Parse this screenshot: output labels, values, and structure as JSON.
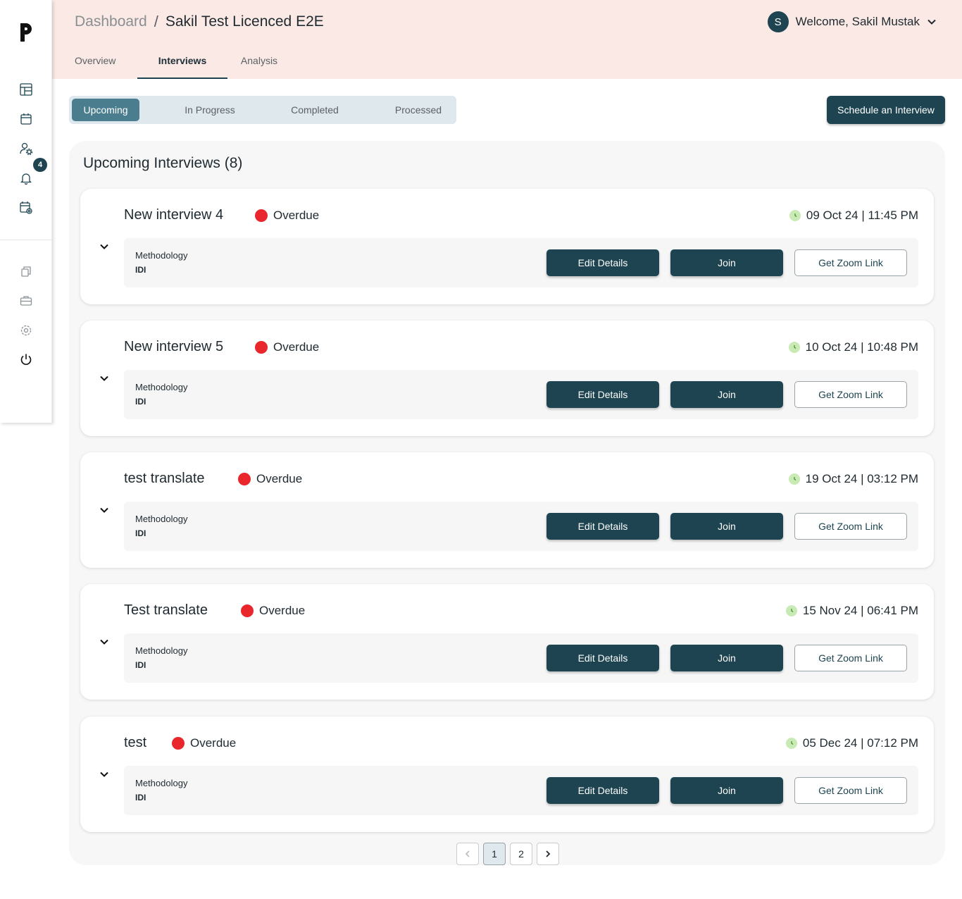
{
  "header": {
    "breadcrumb": [
      "Dashboard",
      "/",
      "Sakil Test Licenced E2E"
    ],
    "welcome": "Welcome, Sakil Mustak",
    "avatar_initial": "S",
    "tabs": [
      "Overview",
      "Interviews",
      "Analysis"
    ],
    "active_tab": "Interviews"
  },
  "sidebar": {
    "notification_count": "4",
    "icons_top": [
      "dashboard-grid-icon",
      "calendar-icon",
      "user-settings-icon",
      "bell-icon",
      "calendar-settings-icon"
    ],
    "icons_bottom": [
      "copy-icon",
      "briefcase-icon",
      "gear-icon",
      "power-icon"
    ]
  },
  "filters": {
    "options": [
      "Upcoming",
      "In Progress",
      "Completed",
      "Processed"
    ],
    "active": "Upcoming"
  },
  "schedule_button": "Schedule an Interview",
  "panel_title": "Upcoming Interviews (8)",
  "interviews": [
    {
      "name": "New interview 4",
      "status": "Overdue",
      "datetime": "09 Oct 24 | 11:45 PM",
      "methodology_label": "Methodology",
      "methodology": "IDI",
      "edit": "Edit Details",
      "join": "Join",
      "zoom": "Get Zoom Link"
    },
    {
      "name": "New interview 5",
      "status": "Overdue",
      "datetime": "10 Oct 24 | 10:48 PM",
      "methodology_label": "Methodology",
      "methodology": "IDI",
      "edit": "Edit Details",
      "join": "Join",
      "zoom": "Get Zoom Link"
    },
    {
      "name": "test translate",
      "status": "Overdue",
      "datetime": "19 Oct 24 | 03:12 PM",
      "methodology_label": "Methodology",
      "methodology": "IDI",
      "edit": "Edit Details",
      "join": "Join",
      "zoom": "Get Zoom Link"
    },
    {
      "name": "Test translate",
      "status": "Overdue",
      "datetime": "15 Nov 24 | 06:41 PM",
      "methodology_label": "Methodology",
      "methodology": "IDI",
      "edit": "Edit Details",
      "join": "Join",
      "zoom": "Get Zoom Link"
    },
    {
      "name": "test",
      "status": "Overdue",
      "datetime": "05 Dec 24 | 07:12 PM",
      "methodology_label": "Methodology",
      "methodology": "IDI",
      "edit": "Edit Details",
      "join": "Join",
      "zoom": "Get Zoom Link"
    }
  ],
  "pagination": {
    "pages": [
      "1",
      "2"
    ],
    "current": "1"
  },
  "colors": {
    "primary": "#1d4450",
    "header_bg": "#fbe9e5",
    "overdue": "#e8262b",
    "clock": "#c9eab5",
    "segment_active": "#4a7e8f"
  }
}
